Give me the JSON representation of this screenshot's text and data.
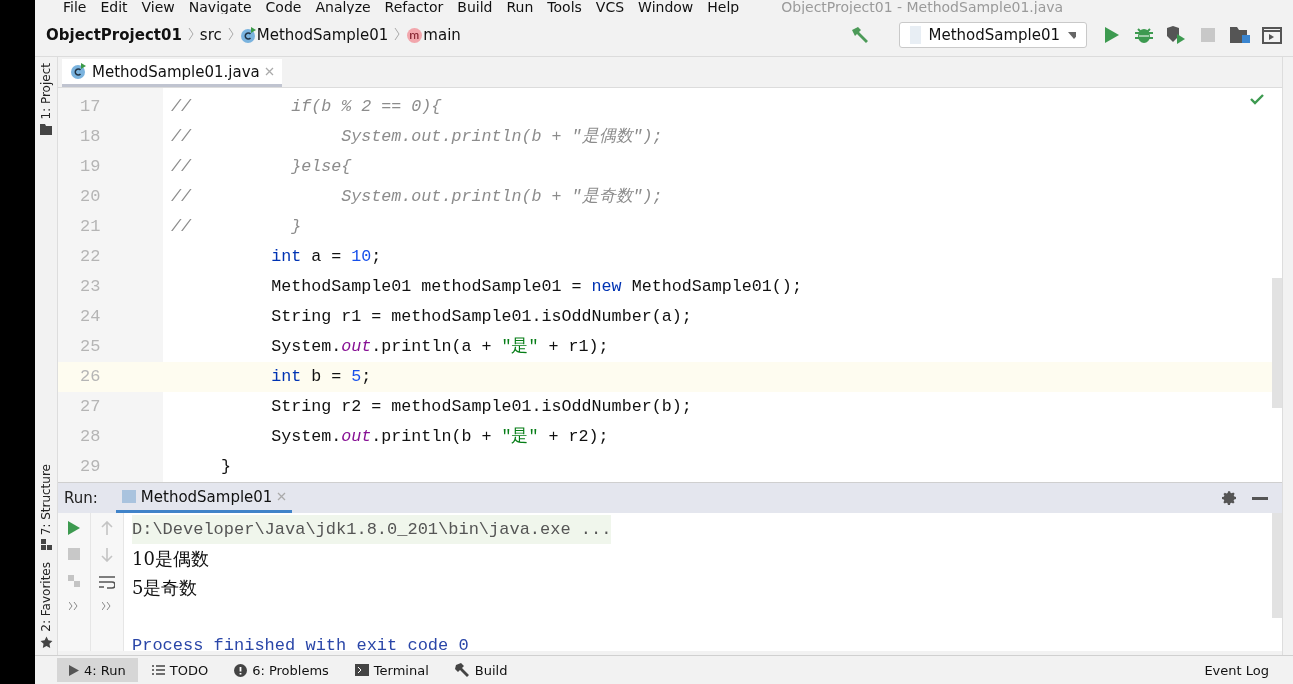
{
  "menu": [
    "File",
    "Edit",
    "View",
    "Navigate",
    "Code",
    "Analyze",
    "Refactor",
    "Build",
    "Run",
    "Tools",
    "VCS",
    "Window",
    "Help"
  ],
  "window_title": "ObjectProject01 - MethodSample01.java",
  "breadcrumb": [
    {
      "kind": "project",
      "label": "ObjectProject01"
    },
    {
      "kind": "folder",
      "label": "src"
    },
    {
      "kind": "class",
      "label": "MethodSample01"
    },
    {
      "kind": "method",
      "label": "main"
    }
  ],
  "run_config": "MethodSample01",
  "editor_tabs": [
    {
      "label": "MethodSample01.java",
      "selected": true
    }
  ],
  "side_tools": [
    {
      "label": "1: Project",
      "kind": "project"
    },
    {
      "label": "7: Structure",
      "kind": "structure"
    },
    {
      "label": "2: Favorites",
      "kind": "favorites"
    }
  ],
  "code_lines": [
    {
      "number": "17",
      "current": false,
      "tokens": [
        {
          "kind": "comment",
          "text": "//          if(b % 2 == 0){"
        }
      ]
    },
    {
      "number": "18",
      "current": false,
      "tokens": [
        {
          "kind": "comment",
          "text": "//               System.out.println(b + \"是偶数\");"
        }
      ]
    },
    {
      "number": "19",
      "current": false,
      "tokens": [
        {
          "kind": "comment",
          "text": "//          }else{"
        }
      ]
    },
    {
      "number": "20",
      "current": false,
      "tokens": [
        {
          "kind": "comment",
          "text": "//               System.out.println(b + \"是奇数\");"
        }
      ]
    },
    {
      "number": "21",
      "current": false,
      "tokens": [
        {
          "kind": "comment",
          "text": "//          }"
        }
      ]
    },
    {
      "number": "22",
      "current": false,
      "kind": "statement",
      "tokens": [
        {
          "kind": "keyword",
          "text": "int"
        },
        {
          "kind": "plain",
          "text": " a = "
        },
        {
          "kind": "number",
          "text": "10"
        },
        {
          "kind": "plain",
          "text": ";"
        }
      ]
    },
    {
      "number": "23",
      "current": false,
      "kind": "statement",
      "tokens": [
        {
          "kind": "plain",
          "text": "MethodSample01 methodSample01 = "
        },
        {
          "kind": "keyword",
          "text": "new"
        },
        {
          "kind": "plain",
          "text": " MethodSample01();"
        }
      ]
    },
    {
      "number": "24",
      "current": false,
      "kind": "statement",
      "tokens": [
        {
          "kind": "plain",
          "text": "String r1 = methodSample01.isOddNumber(a);"
        }
      ]
    },
    {
      "number": "25",
      "current": false,
      "kind": "statement",
      "tokens": [
        {
          "kind": "plain",
          "text": "System."
        },
        {
          "kind": "static",
          "text": "out"
        },
        {
          "kind": "plain",
          "text": ".println(a + "
        },
        {
          "kind": "string",
          "text": "\"是\""
        },
        {
          "kind": "plain",
          "text": " + r1);"
        }
      ]
    },
    {
      "number": "26",
      "current": true,
      "kind": "statement",
      "tokens": [
        {
          "kind": "keyword",
          "text": "int"
        },
        {
          "kind": "plain",
          "text": " b = "
        },
        {
          "kind": "number",
          "text": "5"
        },
        {
          "kind": "plain",
          "text": ";"
        }
      ]
    },
    {
      "number": "27",
      "current": false,
      "kind": "statement",
      "tokens": [
        {
          "kind": "plain",
          "text": "String r2 = methodSample01.isOddNumber(b);"
        }
      ]
    },
    {
      "number": "28",
      "current": false,
      "kind": "statement",
      "tokens": [
        {
          "kind": "plain",
          "text": "System."
        },
        {
          "kind": "static",
          "text": "out"
        },
        {
          "kind": "plain",
          "text": ".println(b + "
        },
        {
          "kind": "string",
          "text": "\"是\""
        },
        {
          "kind": "plain",
          "text": " + r2);"
        }
      ]
    },
    {
      "number": "29",
      "current": false,
      "kind": "block_end",
      "tokens": [
        {
          "kind": "plain",
          "text": "}"
        }
      ]
    }
  ],
  "run_panel": {
    "title": "Run:",
    "tabs": [
      {
        "label": "MethodSample01",
        "selected": true
      }
    ],
    "lines": [
      {
        "kind": "command",
        "text": "D:\\Developer\\Java\\jdk1.8.0_201\\bin\\java.exe ..."
      },
      {
        "kind": "output",
        "text": "10是偶数"
      },
      {
        "kind": "output",
        "text": "5是奇数"
      },
      {
        "kind": "exit",
        "text": "Process finished with exit code 0"
      }
    ]
  },
  "bottom_tools": [
    {
      "label": "4: Run",
      "kind": "run",
      "selected": true
    },
    {
      "label": "TODO",
      "kind": "todo",
      "selected": false
    },
    {
      "label": "6: Problems",
      "kind": "problems",
      "selected": false
    },
    {
      "label": "Terminal",
      "kind": "terminal",
      "selected": false
    },
    {
      "label": "Build",
      "kind": "build",
      "selected": false
    }
  ],
  "event_log": "Event Log"
}
